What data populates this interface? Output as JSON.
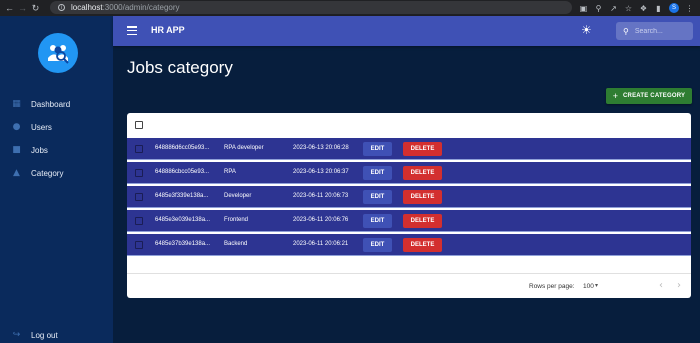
{
  "browser": {
    "url_host": "localhost",
    "url_path": ":3000/admin/category",
    "profile_initial": "S"
  },
  "appbar": {
    "title": "HR APP",
    "search_placeholder": "Search..."
  },
  "sidebar": {
    "items": [
      {
        "label": "Dashboard",
        "icon": "dashboard-icon"
      },
      {
        "label": "Users",
        "icon": "users-icon"
      },
      {
        "label": "Jobs",
        "icon": "briefcase-icon"
      },
      {
        "label": "Category",
        "icon": "category-icon"
      }
    ],
    "logout": "Log out"
  },
  "page": {
    "title": "Jobs category",
    "create_label": "CREATE CATEGORY"
  },
  "table": {
    "edit_label": "EDIT",
    "delete_label": "DELETE",
    "rows": [
      {
        "id": "648886d6cc05e93...",
        "name": "RPA developer",
        "date": "2023-06-13 20:06:28"
      },
      {
        "id": "648886cbcc05e93...",
        "name": "RPA",
        "date": "2023-06-13 20:06:37"
      },
      {
        "id": "6485e3f339e138a...",
        "name": "Developer",
        "date": "2023-06-11 20:06:73"
      },
      {
        "id": "6485e3e039e138a...",
        "name": "Frontend",
        "date": "2023-06-11 20:06:76"
      },
      {
        "id": "6485e37b39e138a...",
        "name": "Backend",
        "date": "2023-06-11 20:06:21"
      }
    ],
    "rows_per_page_label": "Rows per page:",
    "rows_per_page_value": "100"
  },
  "colors": {
    "background": "#071e3d",
    "sidebar": "#0a2a5c",
    "appbar": "#3f51b5",
    "row": "#2d3492",
    "create_button": "#2e7d32",
    "delete_button": "#d32f2f"
  }
}
